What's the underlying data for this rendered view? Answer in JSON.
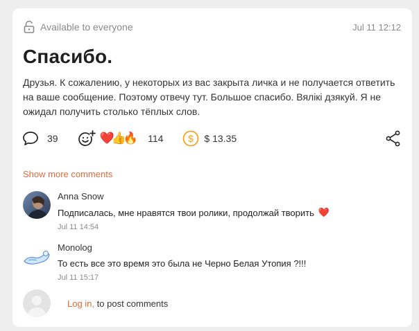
{
  "post": {
    "visibility": "Available to everyone",
    "date": "Jul 11 12:12",
    "title": "Спасибо.",
    "body": "Друзья. К сожалению, у некоторых из вас закрыта личка и не получается ответить на ваше сообщение. Поэтому отвечу тут. Большое спасибо. Вялікі дзякуй. Я не ожидал получить столько тёплых слов."
  },
  "actions": {
    "comments_count": "39",
    "reactions": [
      "❤️",
      "👍",
      "🔥"
    ],
    "reactions_count": "114",
    "donations": "$ 13.35"
  },
  "comments_section": {
    "show_more_label": "Show more comments",
    "items": [
      {
        "author": "Anna Snow",
        "text": "Подписалась, мне нравятся твои ролики, продолжай творить",
        "emoji": "❤️",
        "time": "Jul 11 14:54"
      },
      {
        "author": "Monolog",
        "text": "То есть все это время это была не Черно Белая Утопия ?!!!",
        "time": "Jul 11 15:17"
      }
    ]
  },
  "login": {
    "link_label": "Log in,",
    "suffix": " to post comments"
  },
  "colors": {
    "accent": "#e06a3b",
    "coin": "#f0a21a",
    "muted": "#8a8a8a"
  }
}
